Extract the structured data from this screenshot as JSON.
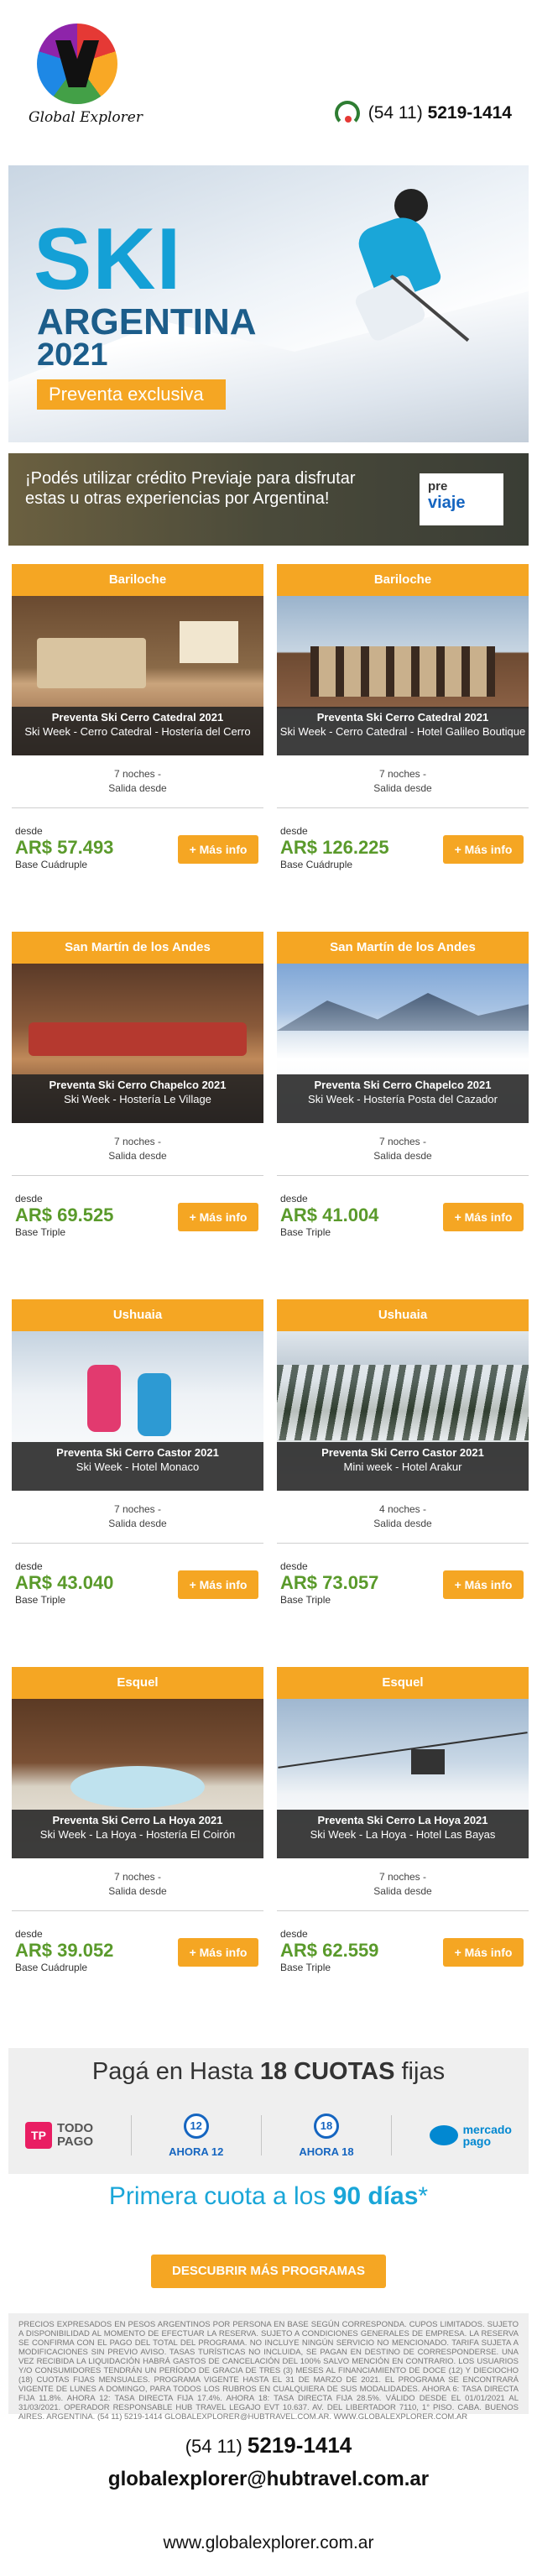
{
  "header": {
    "logo_text": "Global Explorer",
    "phone_prefix": "(54 11)",
    "phone_number": "5219-1414"
  },
  "hero": {
    "title": "SKI",
    "subtitle": "ARGENTINA",
    "year": "2021",
    "tag": "Preventa exclusiva"
  },
  "previaje": {
    "text": "¡Podés utilizar crédito Previaje para disfrutar estas u otras experiencias por Argentina!",
    "logo_line1": "pre",
    "logo_line2": "viaje"
  },
  "products": [
    {
      "dest": "Bariloche",
      "name": "Preventa Ski Cerro Catedral 2021",
      "desc": "Ski Week - Cerro Catedral - Hostería del Cerro",
      "nights": "7 noches -",
      "departure": "Salida desde",
      "from": "desde",
      "price": "AR$ 57.493",
      "base": "Base Cuádruple",
      "btn": "+ Más info"
    },
    {
      "dest": "Bariloche",
      "name": "Preventa Ski Cerro Catedral 2021",
      "desc": "Ski Week - Cerro Catedral - Hotel Galileo Boutique",
      "nights": "7 noches -",
      "departure": "Salida desde",
      "from": "desde",
      "price": "AR$ 126.225",
      "base": "Base Cuádruple",
      "btn": "+ Más info"
    },
    {
      "dest": "San Martín de los Andes",
      "name": "Preventa Ski Cerro Chapelco 2021",
      "desc": "Ski Week - Hostería Le Village",
      "nights": "7 noches -",
      "departure": "Salida desde",
      "from": "desde",
      "price": "AR$ 69.525",
      "base": "Base Triple",
      "btn": "+ Más info"
    },
    {
      "dest": "San Martín de los Andes",
      "name": "Preventa Ski Cerro Chapelco 2021",
      "desc": "Ski Week - Hostería Posta del Cazador",
      "nights": "7 noches -",
      "departure": "Salida desde",
      "from": "desde",
      "price": "AR$ 41.004",
      "base": "Base Triple",
      "btn": "+ Más info"
    },
    {
      "dest": "Ushuaia",
      "name": "Preventa Ski Cerro Castor 2021",
      "desc": "Ski Week - Hotel Monaco",
      "nights": "7 noches -",
      "departure": "Salida desde",
      "from": "desde",
      "price": "AR$ 43.040",
      "base": "Base Triple",
      "btn": "+ Más info"
    },
    {
      "dest": "Ushuaia",
      "name": "Preventa Ski Cerro Castor 2021",
      "desc": "Mini week - Hotel Arakur",
      "nights": "4 noches -",
      "departure": "Salida desde",
      "from": "desde",
      "price": "AR$ 73.057",
      "base": "Base Triple",
      "btn": "+ Más info"
    },
    {
      "dest": "Esquel",
      "name": "Preventa Ski Cerro La Hoya 2021",
      "desc": "Ski Week - La Hoya - Hostería El Coirón",
      "nights": "7 noches -",
      "departure": "Salida desde",
      "from": "desde",
      "price": "AR$ 39.052",
      "base": "Base Cuádruple",
      "btn": "+ Más info"
    },
    {
      "dest": "Esquel",
      "name": "Preventa Ski Cerro La Hoya 2021",
      "desc": "Ski Week - La Hoya - Hotel Las Bayas",
      "nights": "7 noches -",
      "departure": "Salida desde",
      "from": "desde",
      "price": "AR$ 62.559",
      "base": "Base Triple",
      "btn": "+ Más info"
    }
  ],
  "payment": {
    "title_pre": "Pagá en Hasta",
    "title_bold": "18 CUOTAS",
    "title_post": "fijas",
    "todopago_mark": "TP",
    "todopago_l1": "TODO",
    "todopago_l2": "PAGO",
    "ahora12": "AHORA 12",
    "ahora18": "AHORA 18",
    "ahora12_num": "12",
    "ahora18_num": "18",
    "mp_l1": "mercado",
    "mp_l2": "pago",
    "first_fee_pre": "Primera cuota a los",
    "first_fee_bold": "90 días",
    "first_fee_post": "*"
  },
  "cta_label": "DESCUBRIR MÁS PROGRAMAS",
  "legal": "PRECIOS EXPRESADOS EN PESOS ARGENTINOS POR PERSONA EN BASE SEGÚN CORRESPONDA. CUPOS LIMITADOS. SUJETO A DISPONIBILIDAD AL MOMENTO DE EFECTUAR LA RESERVA. SUJETO A CONDICIONES GENERALES DE EMPRESA. LA RESERVA SE CONFIRMA CON EL PAGO DEL TOTAL DEL PROGRAMA. NO INCLUYE NINGÚN SERVICIO NO MENCIONADO. TARIFA SUJETA A MODIFICACIONES SIN PREVIO AVISO. TASAS TURÍSTICAS NO INCLUIDA, SE PAGAN EN DESTINO DE CORRESPONDERSE. UNA VEZ RECIBIDA LA LIQUIDACIÓN HABRÁ GASTOS DE CANCELACIÓN DEL 100% SALVO MENCIÓN EN CONTRARIO. LOS USUARIOS Y/O CONSUMIDORES TENDRÁN UN PERÍODO DE GRACIA DE TRES (3) MESES AL FINANCIAMIENTO DE DOCE (12) Y DIECIOCHO (18) CUOTAS FIJAS MENSUALES. PROGRAMA VIGENTE HASTA EL 31 DE MARZO DE 2021. EL PROGRAMA SE ENCONTRARÁ VIGENTE DE LUNES A DOMINGO, PARA TODOS LOS RUBROS EN CUALQUIERA DE SUS MODALIDADES. AHORA 6: TASA DIRECTA FIJA 11.8%. AHORA 12: TASA DIRECTA FIJA 17.4%. AHORA 18: TASA DIRECTA FIJA 28.5%. VÁLIDO DESDE EL 01/01/2021 AL 31/03/2021. OPERADOR RESPONSABLE HUB TRAVEL LEGAJO EVT 10.637. AV. DEL LIBERTADOR 7110, 1° PISO. CABA. BUENOS AIRES. ARGENTINA. (54 11) 5219-1414 GLOBALEXPLORER@HUBTRAVEL.COM.AR. WWW.GLOBALEXPLORER.COM.AR",
  "footer": {
    "phone_prefix": "(54 11)",
    "phone_number": "5219-1414",
    "email": "globalexplorer@hubtravel.com.ar",
    "web": "www.globalexplorer.com.ar"
  },
  "colors": {
    "accent": "#f5a623",
    "price": "#5a9a2b",
    "brand_blue": "#14a0d6",
    "footer_bg": "#efefef"
  }
}
